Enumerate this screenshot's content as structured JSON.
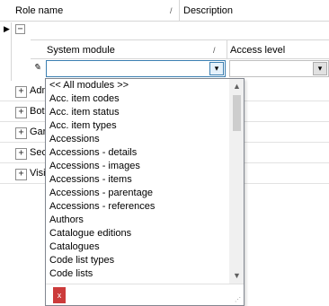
{
  "grid": {
    "columns": [
      {
        "label": "Role name"
      },
      {
        "label": "Description"
      }
    ],
    "rows": [
      {
        "label": "Adm"
      },
      {
        "label": "Bota"
      },
      {
        "label": "Garc"
      },
      {
        "label": "Secu"
      },
      {
        "label": "Visit"
      }
    ]
  },
  "detail": {
    "columns": [
      {
        "label": "System module"
      },
      {
        "label": "Access level"
      }
    ],
    "module_value": "",
    "access_value": ""
  },
  "dropdown": {
    "items": [
      "<< All modules >>",
      "Acc. item codes",
      "Acc. item status",
      "Acc. item types",
      "Accessions",
      "Accessions - details",
      "Accessions - images",
      "Accessions - items",
      "Accessions - parentage",
      "Accessions - references",
      "Authors",
      "Catalogue editions",
      "Catalogues",
      "Code list types",
      "Code lists"
    ],
    "clear_label": "x"
  },
  "colors": {
    "focus_border": "#3c7fb1",
    "clear_button": "#cc3b3b"
  }
}
